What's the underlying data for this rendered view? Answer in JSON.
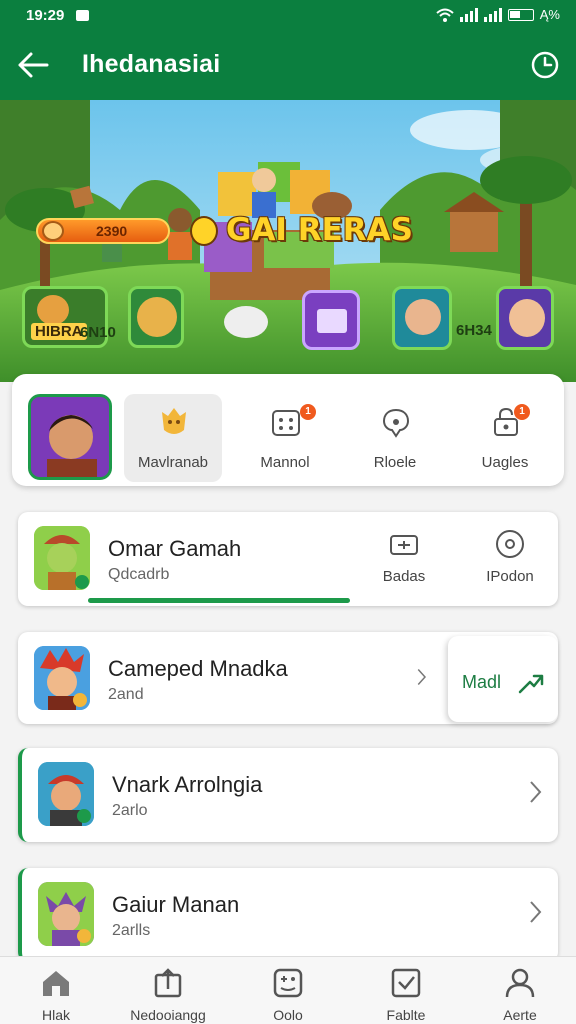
{
  "status_bar": {
    "time": "19:29",
    "battery": "Ą%"
  },
  "app_bar": {
    "title": "Ihedanasiai",
    "back_icon": "arrow-left-icon",
    "history_icon": "clock-icon"
  },
  "banner": {
    "title": "GAI RERAS",
    "coins": "2390",
    "tile_left_label": "HIBRA",
    "tile_left_value": "6N10",
    "tile_right_value": "6H34"
  },
  "tabs": {
    "items": [
      {
        "label": "Mavlranab",
        "icon": "shield-face-icon",
        "badge": "",
        "selected": true
      },
      {
        "label": "Mannol",
        "icon": "grid-dots-icon",
        "badge": "1",
        "selected": false
      },
      {
        "label": "Rloele",
        "icon": "chat-bubble-icon",
        "badge": "",
        "selected": false
      },
      {
        "label": "Uagles",
        "icon": "lock-icon",
        "badge": "1",
        "selected": false
      }
    ]
  },
  "list": [
    {
      "name": "Omar Gamah",
      "sub": "Qdcadrb",
      "actions": [
        {
          "label": "Badas",
          "icon": "battery-icon"
        },
        {
          "label": "IPodon",
          "icon": "target-icon"
        }
      ],
      "progress": 1.0
    },
    {
      "name": "Cameped Mnadka",
      "sub": "2and",
      "mode_label": "Madl"
    },
    {
      "name": "Vnark Arrolngia",
      "sub": "2arlo"
    },
    {
      "name": "Gaiur Manan",
      "sub": "2arlls"
    }
  ],
  "bottom_nav": [
    {
      "label": "Hlak",
      "icon": "home-icon"
    },
    {
      "label": "Nedooiangg",
      "icon": "upload-box-icon"
    },
    {
      "label": "Oolo",
      "icon": "controller-icon"
    },
    {
      "label": "Fablte",
      "icon": "check-box-icon"
    },
    {
      "label": "Aerte",
      "icon": "user-icon"
    }
  ],
  "colors": {
    "primary": "#0b7f3f",
    "accent": "#1d9a4a",
    "badge": "#f05a1e"
  }
}
